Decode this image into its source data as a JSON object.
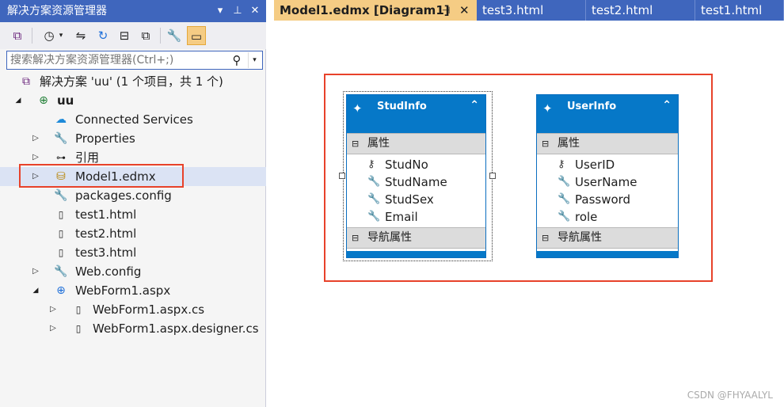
{
  "solution_explorer": {
    "title": "解决方案资源管理器",
    "title_buttons": [
      "▾",
      "⊥",
      "✕"
    ],
    "search_placeholder": "搜索解决方案资源管理器(Ctrl+;)",
    "toolbar_icons": [
      "vs-icon",
      "history-icon",
      "dropdown-icon",
      "sync-icon",
      "refresh-icon",
      "collapse-all-icon",
      "show-all-icon",
      "properties-wrench-icon",
      "preview-icon"
    ],
    "tree": [
      {
        "label": "解决方案 'uu' (1 个项目，共 1 个)",
        "icon": "solution-icon",
        "expander": ""
      },
      {
        "label": "uu",
        "icon": "web-project-icon",
        "expander": "◢"
      },
      {
        "label": "Connected Services",
        "icon": "cloud-icon",
        "expander": ""
      },
      {
        "label": "Properties",
        "icon": "wrench-icon",
        "expander": "▷"
      },
      {
        "label": "引用",
        "icon": "references-icon",
        "expander": "▷"
      },
      {
        "label": "Model1.edmx",
        "icon": "edmx-icon",
        "expander": "▷"
      },
      {
        "label": "packages.config",
        "icon": "config-icon",
        "expander": ""
      },
      {
        "label": "test1.html",
        "icon": "html-file-icon",
        "expander": ""
      },
      {
        "label": "test2.html",
        "icon": "html-file-icon",
        "expander": ""
      },
      {
        "label": "test3.html",
        "icon": "html-file-icon",
        "expander": ""
      },
      {
        "label": "Web.config",
        "icon": "config-icon",
        "expander": "▷"
      },
      {
        "label": "WebForm1.aspx",
        "icon": "aspx-icon",
        "expander": "◢"
      },
      {
        "label": "WebForm1.aspx.cs",
        "icon": "cs-file-icon",
        "expander": "▷"
      },
      {
        "label": "WebForm1.aspx.designer.cs",
        "icon": "cs-file-icon",
        "expander": "▷"
      }
    ]
  },
  "tabs": [
    {
      "label": "Model1.edmx [Diagram1]",
      "active": true
    },
    {
      "label": "test3.html",
      "active": false
    },
    {
      "label": "test2.html",
      "active": false
    },
    {
      "label": "test1.html",
      "active": false
    }
  ],
  "tab_glyphs": {
    "pin": "⊣",
    "close": "✕"
  },
  "entities": [
    {
      "name": "StudInfo",
      "section_properties": "属性",
      "section_navigation": "导航属性",
      "properties": [
        {
          "name": "StudNo",
          "key": true
        },
        {
          "name": "StudName",
          "key": false
        },
        {
          "name": "StudSex",
          "key": false
        },
        {
          "name": "Email",
          "key": false
        }
      ]
    },
    {
      "name": "UserInfo",
      "section_properties": "属性",
      "section_navigation": "导航属性",
      "properties": [
        {
          "name": "UserID",
          "key": true
        },
        {
          "name": "UserName",
          "key": false
        },
        {
          "name": "Password",
          "key": false
        },
        {
          "name": "role",
          "key": false
        }
      ]
    }
  ],
  "glyphs": {
    "minus": "⊟",
    "collapse": "⌃",
    "entity": "✦",
    "key": "⚷",
    "wrench": "🔧"
  },
  "watermark": "CSDN @FHYAALYL",
  "colors": {
    "accent": "#3f66bd",
    "active_tab": "#f5cc84",
    "entity_header": "#0678c8",
    "highlight": "#e8422a"
  }
}
